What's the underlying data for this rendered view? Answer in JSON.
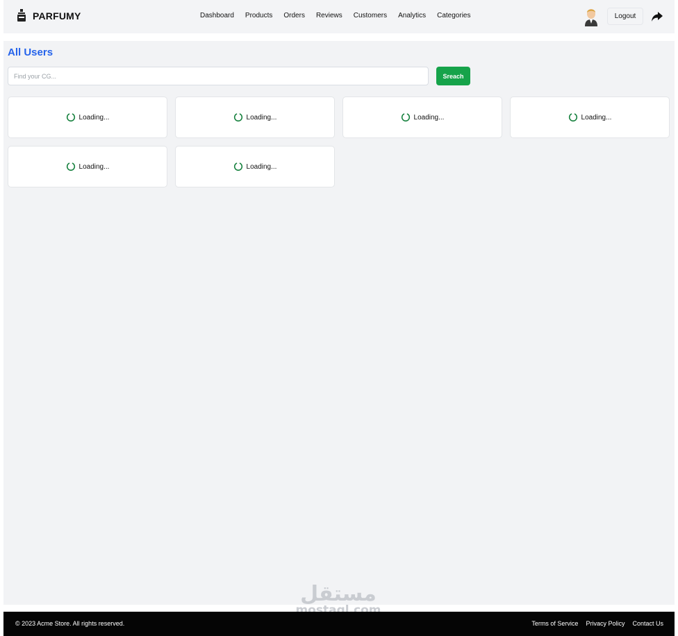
{
  "brand": {
    "name": "PARFUMY",
    "icon": "perfume-bottle-icon"
  },
  "nav": {
    "items": [
      {
        "label": "Dashboard"
      },
      {
        "label": "Products"
      },
      {
        "label": "Orders"
      },
      {
        "label": "Reviews"
      },
      {
        "label": "Customers"
      },
      {
        "label": "Analytics"
      },
      {
        "label": "Categories"
      }
    ]
  },
  "header": {
    "logout_label": "Logout",
    "share_icon": "share-icon",
    "avatar_icon": "user-avatar-icon"
  },
  "page": {
    "title": "All Users"
  },
  "search": {
    "placeholder": "Find your CG...",
    "value": "",
    "button_label": "Sreach"
  },
  "cards": [
    {
      "status": "Loading..."
    },
    {
      "status": "Loading..."
    },
    {
      "status": "Loading..."
    },
    {
      "status": "Loading..."
    },
    {
      "status": "Loading..."
    },
    {
      "status": "Loading..."
    }
  ],
  "footer": {
    "copyright": "© 2023 Acme Store. All rights reserved.",
    "links": [
      {
        "label": "Terms of Service"
      },
      {
        "label": "Privacy Policy"
      },
      {
        "label": "Contact Us"
      }
    ]
  },
  "watermark": {
    "arabic": "مستقل",
    "latin": "mostaql.com"
  },
  "colors": {
    "accent_blue": "#2563eb",
    "button_green": "#16a34a",
    "spinner_green": "#15803d",
    "footer_bg": "#050505"
  }
}
